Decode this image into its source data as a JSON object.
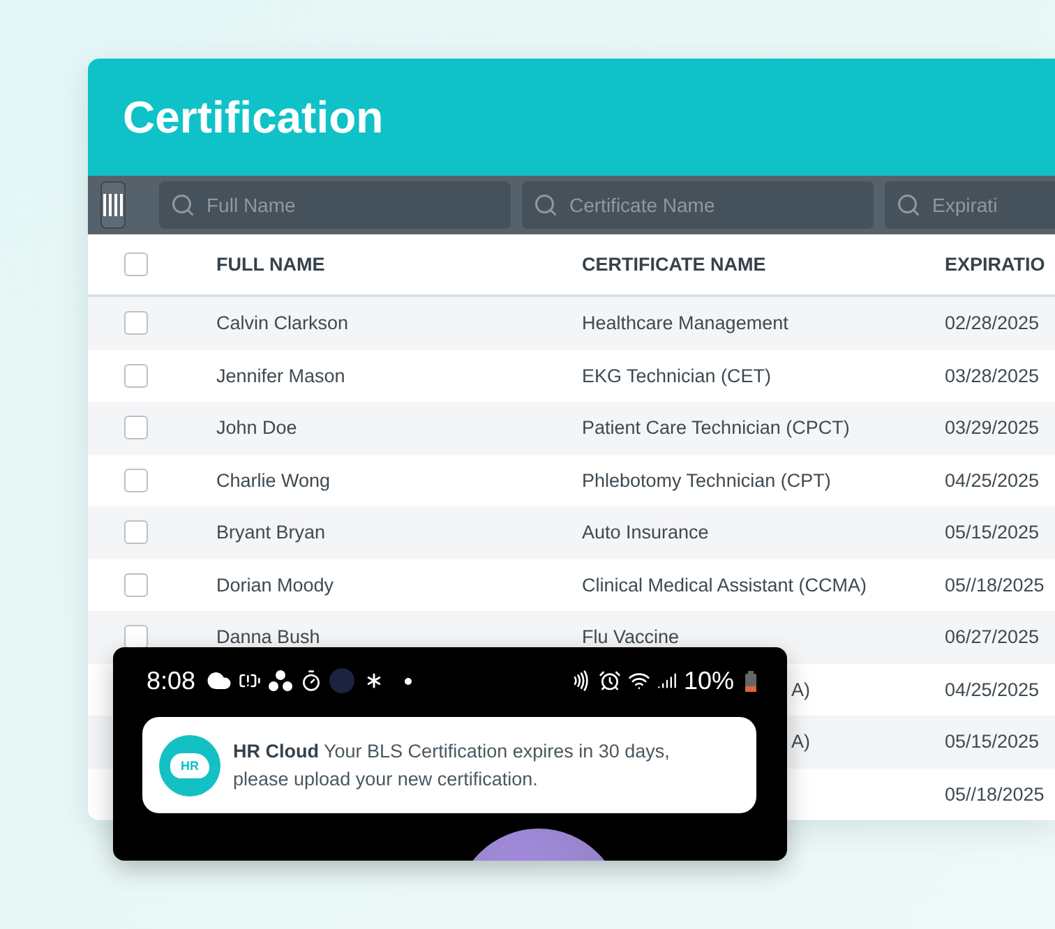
{
  "title": "Certification",
  "filters": [
    {
      "placeholder": "Full Name"
    },
    {
      "placeholder": "Certificate Name"
    },
    {
      "placeholder": "Expirati"
    }
  ],
  "header": {
    "checked": false,
    "columns": [
      "FULL NAME",
      "CERTIFICATE NAME",
      "EXPIRATIO"
    ]
  },
  "rows": [
    {
      "checked": false,
      "name": "Calvin Clarkson",
      "certificate": "Healthcare Management",
      "expiration": "02/28/2025"
    },
    {
      "checked": false,
      "name": "Jennifer Mason",
      "certificate": "EKG Technician (CET)",
      "expiration": "03/28/2025"
    },
    {
      "checked": false,
      "name": "John Doe",
      "certificate": "Patient Care Technician (CPCT)",
      "expiration": "03/29/2025"
    },
    {
      "checked": false,
      "name": "Charlie Wong",
      "certificate": "Phlebotomy Technician (CPT)",
      "expiration": "04/25/2025"
    },
    {
      "checked": false,
      "name": "Bryant Bryan",
      "certificate": "Auto Insurance",
      "expiration": "05/15/2025"
    },
    {
      "checked": false,
      "name": "Dorian Moody",
      "certificate": "Clinical Medical Assistant (CCMA)",
      "expiration": "05//18/2025"
    },
    {
      "checked": false,
      "name": "Danna Bush",
      "certificate": "Flu Vaccine",
      "expiration": "06/27/2025"
    },
    {
      "certificate": "A)",
      "expiration": "04/25/2025"
    },
    {
      "certificate": "A)",
      "expiration": "05/15/2025"
    },
    {
      "expiration": "05//18/2025"
    }
  ],
  "phone": {
    "time": "8:08",
    "battery": "10%",
    "notification": {
      "icon_text": "HR",
      "app": "HR Cloud",
      "message": "Your BLS Certification expires in 30 days, please upload your new certification."
    }
  }
}
